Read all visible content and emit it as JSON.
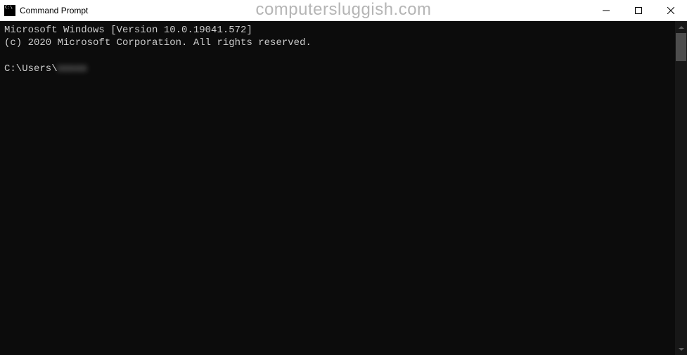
{
  "window": {
    "title": "Command Prompt"
  },
  "watermark": "computersluggish.com",
  "terminal": {
    "line1": "Microsoft Windows [Version 10.0.19041.572]",
    "line2": "(c) 2020 Microsoft Corporation. All rights reserved.",
    "prompt_prefix": "C:\\Users\\",
    "prompt_user_blurred": "xxxxx"
  }
}
